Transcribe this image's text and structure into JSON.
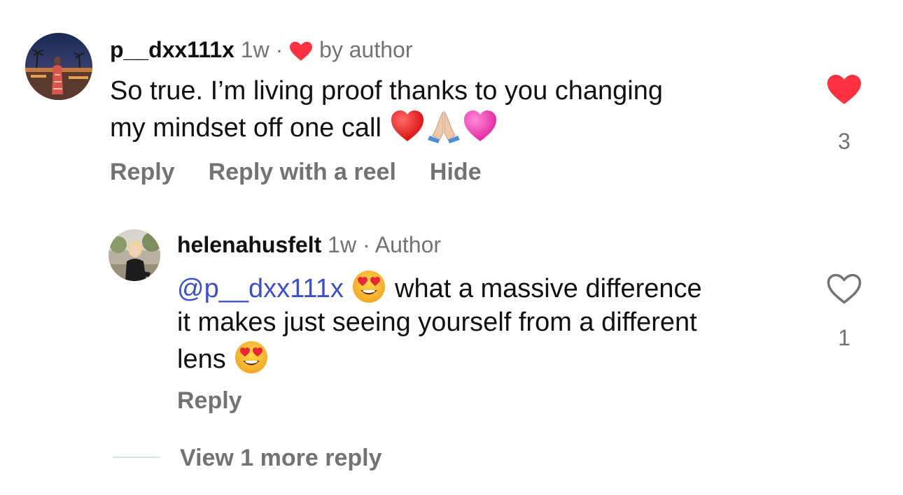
{
  "comment": {
    "username": "p__dxx111x",
    "time": "1w",
    "separator": "·",
    "liked_by_author_label": "by author",
    "text_line1": "So true. I’m living proof thanks to you changing",
    "text_line2": "my mindset off one call",
    "emojis": [
      "red-heart",
      "folded-hands-light-skin",
      "pink-heart"
    ],
    "actions": {
      "reply": "Reply",
      "reply_with_reel": "Reply with a reel",
      "hide": "Hide"
    },
    "likes": "3",
    "liked": true
  },
  "reply": {
    "username": "helenahusfelt",
    "time": "1w",
    "separator": "·",
    "role": "Author",
    "mention": "@p__dxx111x",
    "text_line1": "what a massive difference",
    "text_line2": "it makes just seeing yourself from a different",
    "text_line3": "lens",
    "emojis": [
      "heart-eyes-face",
      "heart-eyes-face"
    ],
    "actions": {
      "reply": "Reply"
    },
    "likes": "1",
    "liked": false
  },
  "view_more": "View 1 more reply",
  "colors": {
    "like_red": "#ff3040",
    "muted_text": "#737373",
    "mention_blue": "#3b4fcf",
    "primary_text": "#111111"
  }
}
